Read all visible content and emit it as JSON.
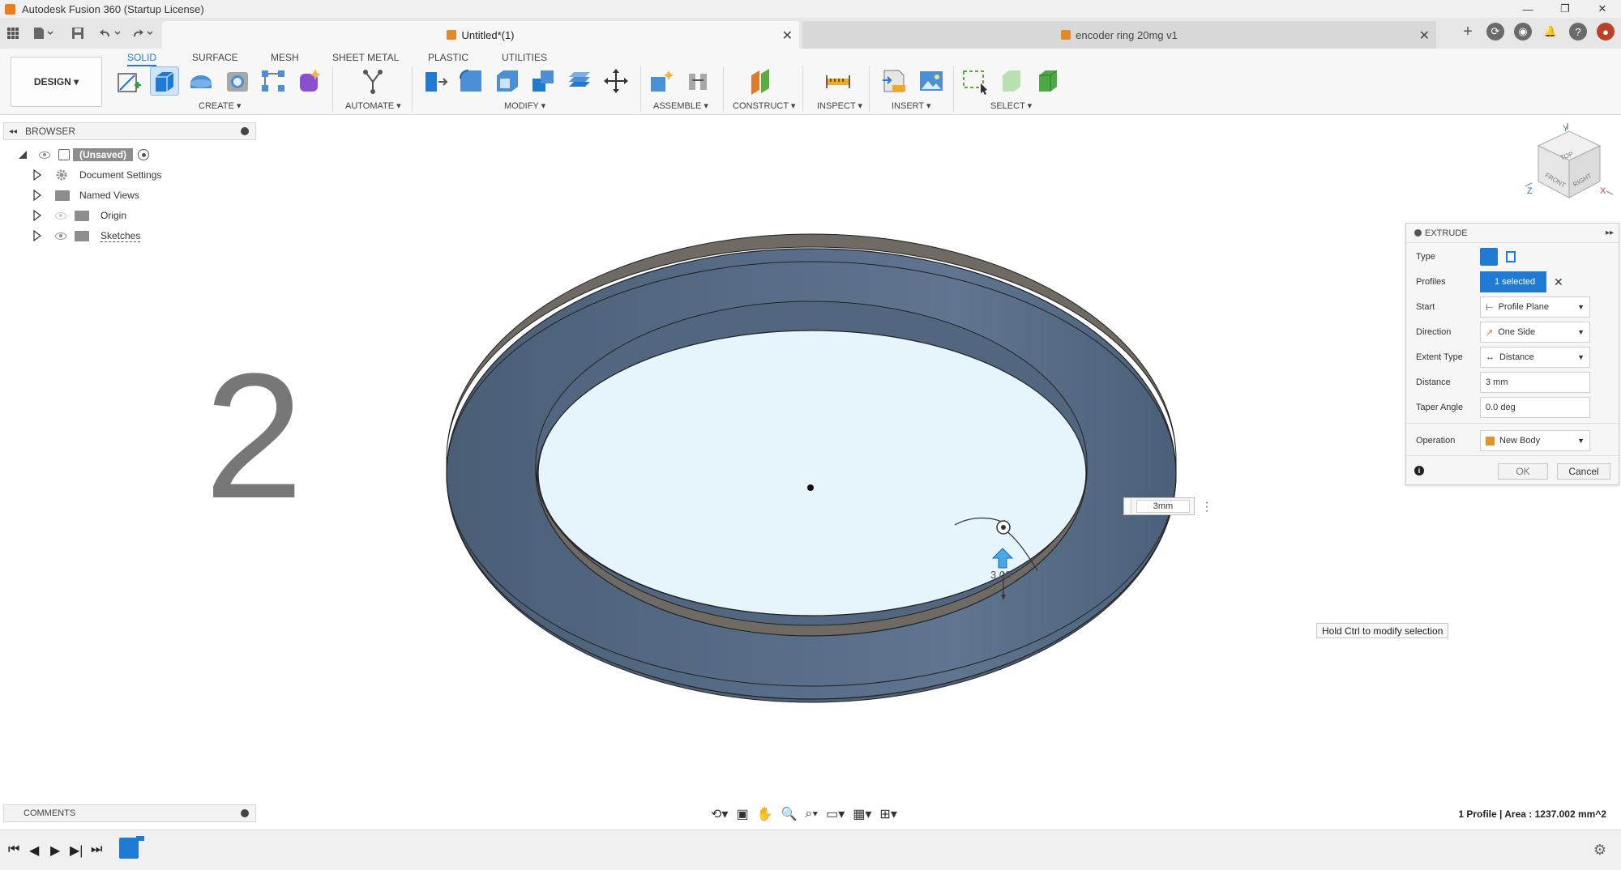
{
  "window": {
    "app_title": "Autodesk Fusion 360 (Startup License)",
    "minimize": "—",
    "maximize": "❐",
    "close": "✕"
  },
  "tabs": {
    "active": {
      "label": "Untitled*(1)",
      "close": "✕"
    },
    "inactive": {
      "label": "encoder ring 20mg v1",
      "close": "✕"
    }
  },
  "ribbon": {
    "workspace": "DESIGN ▾",
    "tabs": [
      "SOLID",
      "SURFACE",
      "MESH",
      "SHEET METAL",
      "PLASTIC",
      "UTILITIES"
    ],
    "groups": [
      "CREATE ▾",
      "AUTOMATE ▾",
      "MODIFY ▾",
      "ASSEMBLE ▾",
      "CONSTRUCT ▾",
      "INSPECT ▾",
      "INSERT ▾",
      "SELECT ▾"
    ]
  },
  "browser": {
    "title": "BROWSER",
    "root": "(Unsaved)",
    "items": [
      "Document Settings",
      "Named Views",
      "Origin",
      "Sketches"
    ]
  },
  "viewport": {
    "step_number": "2",
    "dimension_value": "3mm",
    "dimension_annotation": "3.00",
    "tooltip": "Hold Ctrl to modify selection",
    "status": "1 Profile | Area : 1237.002 mm^2",
    "viewcube": {
      "top": "TOP",
      "front": "FRONT",
      "right": "RIGHT",
      "axis_x": "X",
      "axis_y": "Y",
      "axis_z": "Z"
    }
  },
  "extrude": {
    "title": "EXTRUDE",
    "labels": {
      "type": "Type",
      "profiles": "Profiles",
      "start": "Start",
      "direction": "Direction",
      "extent_type": "Extent Type",
      "distance": "Distance",
      "taper_angle": "Taper Angle",
      "operation": "Operation"
    },
    "values": {
      "profiles": "1 selected",
      "start": "Profile Plane",
      "direction": "One Side",
      "extent_type": "Distance",
      "distance": "3 mm",
      "taper_angle": "0.0 deg",
      "operation": "New Body"
    },
    "ok": "OK",
    "cancel": "Cancel"
  },
  "comments": {
    "title": "COMMENTS"
  },
  "colors": {
    "accent": "#1f7ad4",
    "ring_top": "#5b7089",
    "ring_side": "#6f6a63",
    "profile_fill": "#e6f4fb"
  }
}
